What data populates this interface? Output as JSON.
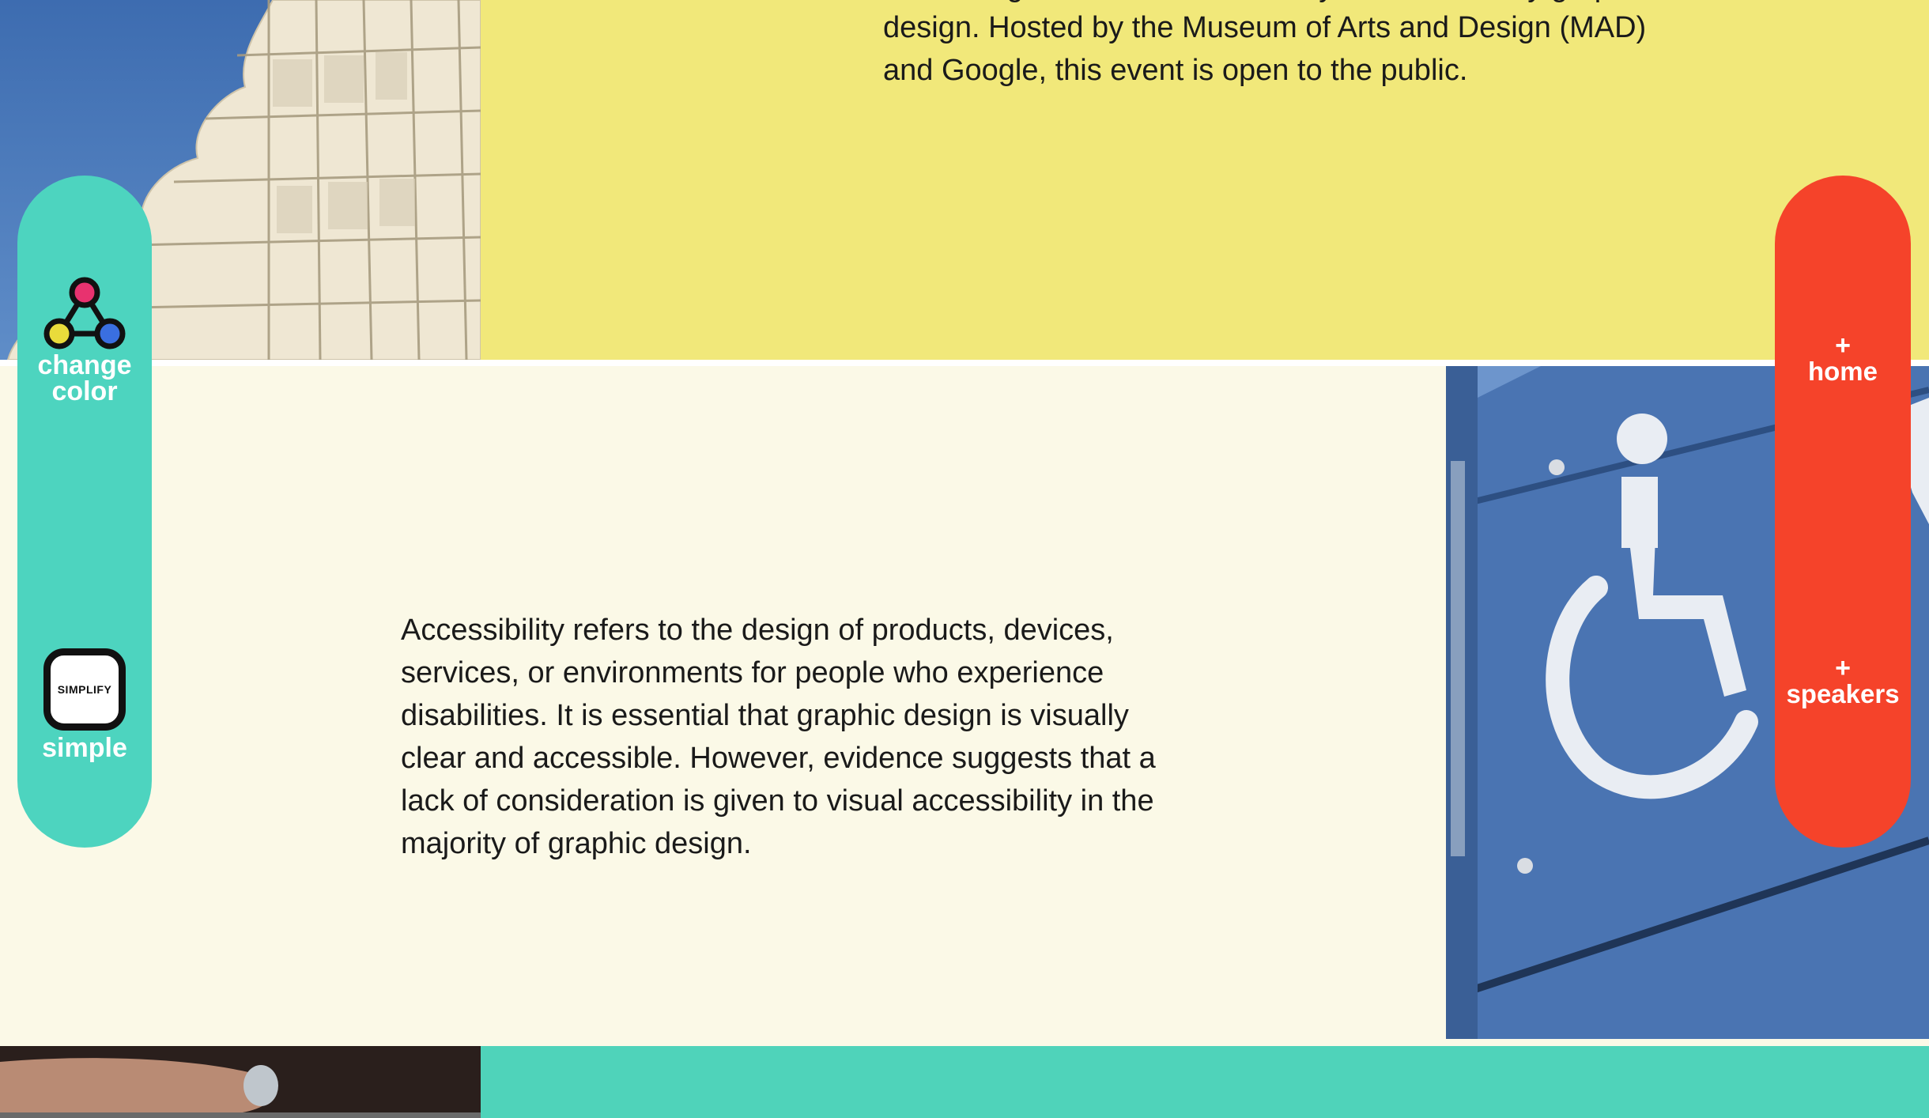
{
  "intro": {
    "lines": [
      "discussing the role of accessibility in modern- day graphic",
      "design. Hosted by the Museum of Arts and Design (MAD)",
      "and Google, this event is open to the public."
    ]
  },
  "about": {
    "lines": [
      "Accessibility refers to the design of products, devices,",
      "services, or environments for people who experience",
      "disabilities. It is essential that graphic design is visually",
      "clear and accessible. However, evidence suggests that a",
      "lack of consideration is given to visual accessibility in the",
      "majority of graphic design."
    ]
  },
  "tools": {
    "change_color": {
      "line1": "change",
      "line2": "color",
      "icon": "color-nodes-icon"
    },
    "simplify": {
      "badge": "SIMPLIFY",
      "label": "simple",
      "icon": "simplify-icon"
    }
  },
  "nav": {
    "home": {
      "plus": "+",
      "label": "home"
    },
    "speakers": {
      "plus": "+",
      "label": "speakers"
    }
  },
  "colors": {
    "yellow": "#f1e87a",
    "cream": "#fbf9e7",
    "teal": "#4dd4bf",
    "red": "#f5432a",
    "node_pink": "#e8326f",
    "node_yellow": "#e9db3b",
    "node_blue": "#3a6fe0"
  }
}
